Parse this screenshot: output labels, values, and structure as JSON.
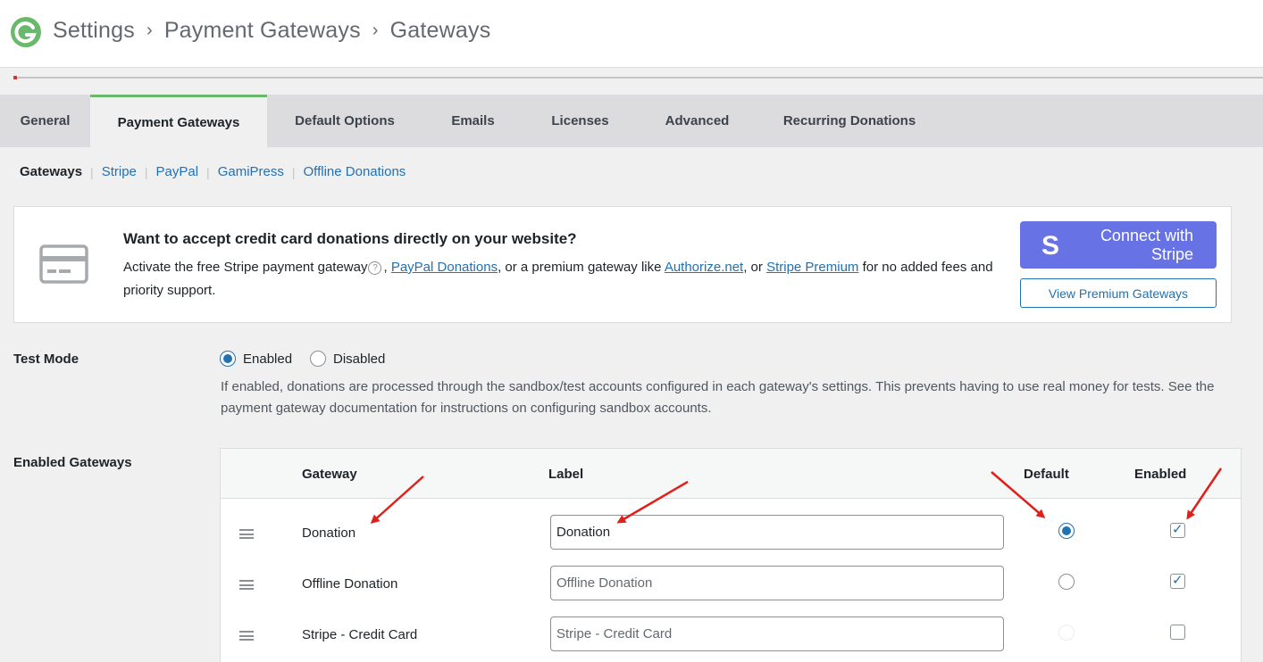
{
  "header": {
    "breadcrumbs": [
      "Settings",
      "Payment Gateways",
      "Gateways"
    ],
    "separator": "›"
  },
  "tabs": [
    {
      "label": "General",
      "active": false
    },
    {
      "label": "Payment Gateways",
      "active": true
    },
    {
      "label": "Default Options",
      "active": false
    },
    {
      "label": "Emails",
      "active": false
    },
    {
      "label": "Licenses",
      "active": false
    },
    {
      "label": "Advanced",
      "active": false
    },
    {
      "label": "Recurring Donations",
      "active": false
    }
  ],
  "subnav": {
    "current": "Gateways",
    "links": [
      "Stripe",
      "PayPal",
      "GamiPress",
      "Offline Donations"
    ],
    "divider": "|"
  },
  "promo": {
    "title": "Want to accept credit card donations directly on your website?",
    "text_before": "Activate the free Stripe payment gateway",
    "help_glyph": "?",
    "text_comma": ", ",
    "link_paypal": "PayPal Donations",
    "text_mid": ", or a premium gateway like ",
    "link_authorize": "Authorize.net",
    "text_or": ", or ",
    "link_stripe_premium": "Stripe Premium",
    "text_after": " for no added fees and priority support.",
    "stripe_button_icon": "S",
    "stripe_button": "Connect with Stripe",
    "premium_button": "View Premium Gateways"
  },
  "test_mode": {
    "label": "Test Mode",
    "options": [
      "Enabled",
      "Disabled"
    ],
    "selected": "Enabled",
    "description": "If enabled, donations are processed through the sandbox/test accounts configured in each gateway's settings. This prevents having to use real money for tests. See the payment gateway documentation for instructions on configuring sandbox accounts."
  },
  "enabled_gateways": {
    "label": "Enabled Gateways",
    "columns": [
      "Gateway",
      "Label",
      "Default",
      "Enabled"
    ],
    "rows": [
      {
        "gateway": "Donation",
        "label_value": "Donation",
        "placeholder": "Donation",
        "default": true,
        "enabled": true
      },
      {
        "gateway": "Offline Donation",
        "label_value": "",
        "placeholder": "Offline Donation",
        "default": false,
        "enabled": true
      },
      {
        "gateway": "Stripe - Credit Card",
        "label_value": "",
        "placeholder": "Stripe - Credit Card",
        "default": false,
        "enabled": false
      }
    ]
  },
  "colors": {
    "accent": "#2271b1",
    "stripe": "#6772e5",
    "active_tab_border": "#69b86b",
    "annotation_arrow": "#e0201a",
    "logo": "#69b86b"
  }
}
